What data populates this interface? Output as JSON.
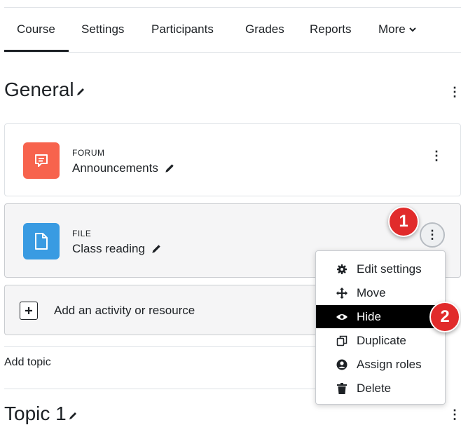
{
  "nav": {
    "tabs": [
      {
        "label": "Course"
      },
      {
        "label": "Settings"
      },
      {
        "label": "Participants"
      },
      {
        "label": "Grades"
      },
      {
        "label": "Reports"
      },
      {
        "label": "More"
      }
    ]
  },
  "section_general": {
    "title": "General"
  },
  "activities": [
    {
      "type": "FORUM",
      "name": "Announcements",
      "icon": "forum-icon",
      "color": "#f7634d"
    },
    {
      "type": "FILE",
      "name": "Class reading",
      "icon": "file-icon",
      "color": "#399be2"
    }
  ],
  "add_activity": {
    "label": "Add an activity or resource"
  },
  "add_topic": {
    "label": "Add topic"
  },
  "section_topic": {
    "title": "Topic 1"
  },
  "menu": {
    "items": [
      {
        "label": "Edit settings",
        "icon": "gear-icon"
      },
      {
        "label": "Move",
        "icon": "move-icon"
      },
      {
        "label": "Hide",
        "icon": "eye-icon",
        "active": true
      },
      {
        "label": "Duplicate",
        "icon": "duplicate-icon"
      },
      {
        "label": "Assign roles",
        "icon": "user-icon"
      },
      {
        "label": "Delete",
        "icon": "trash-icon"
      }
    ]
  },
  "annotations": {
    "step1": "1",
    "step2": "2",
    "color": "#e12b2b"
  }
}
